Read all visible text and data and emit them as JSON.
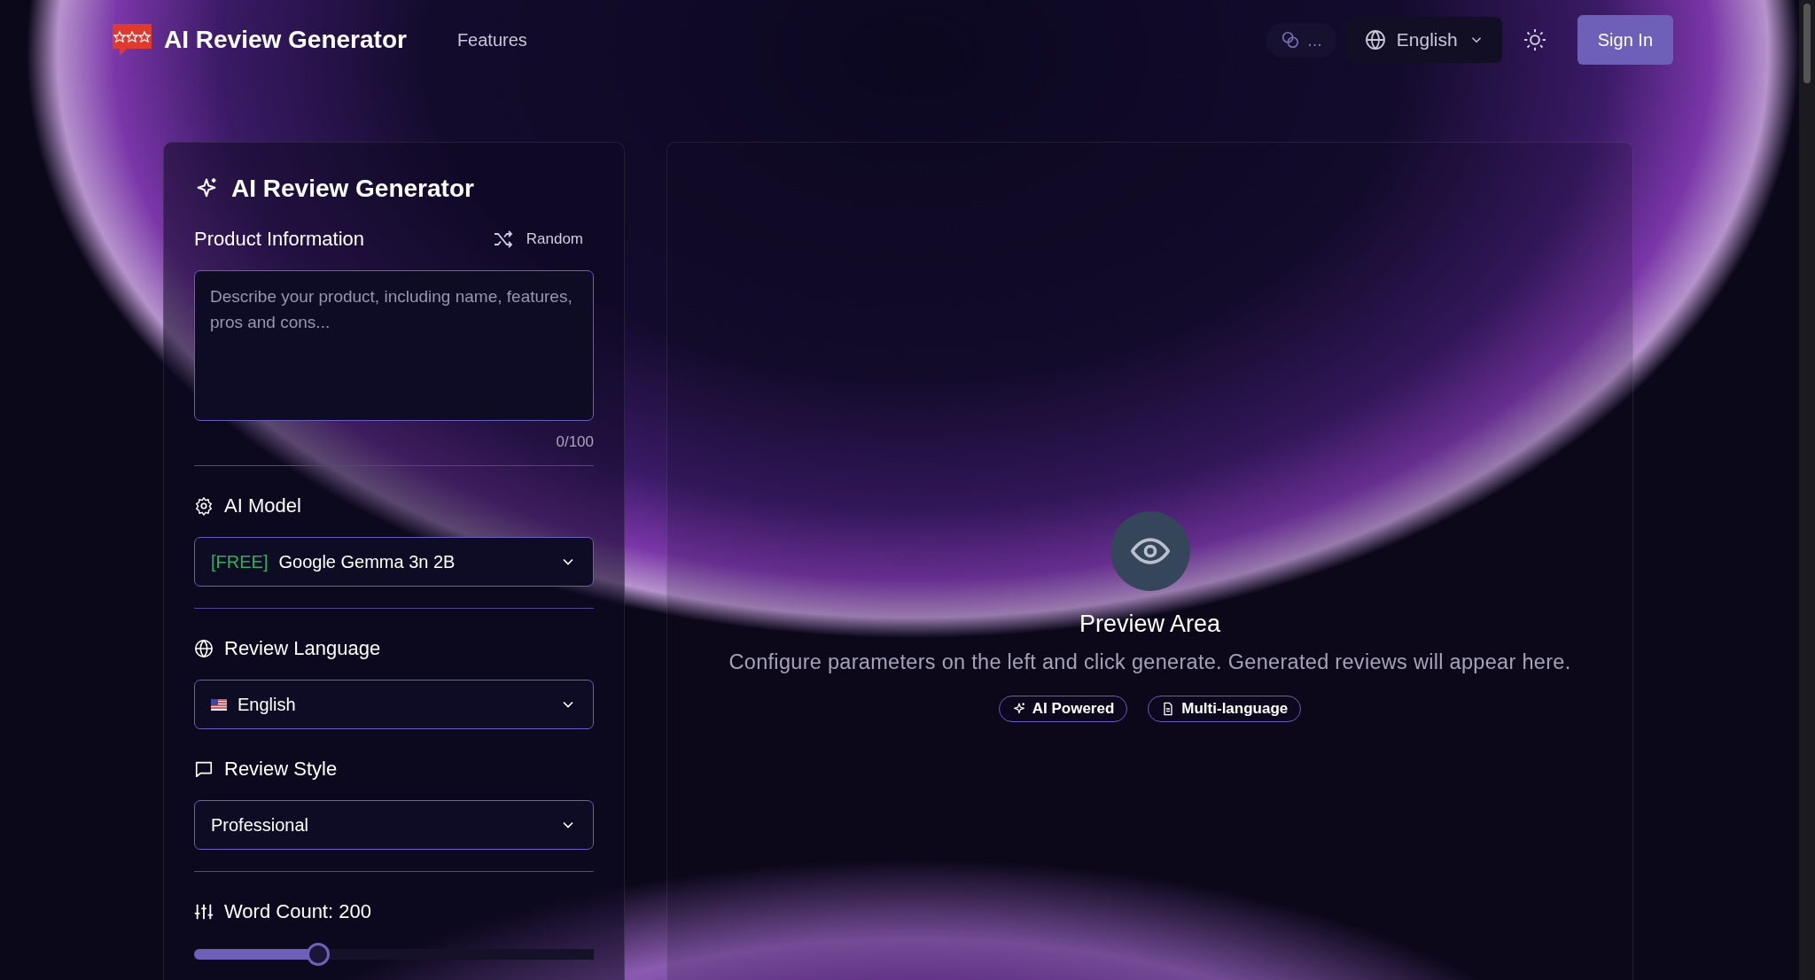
{
  "header": {
    "brand": "AI Review Generator",
    "nav": [
      {
        "label": "Features"
      }
    ],
    "credits": "...",
    "language": "English",
    "sign_in": "Sign In"
  },
  "form": {
    "title": "AI Review Generator",
    "product": {
      "label": "Product Information",
      "random": "Random",
      "placeholder": "Describe your product, including name, features, pros and cons...",
      "counter": "0/100"
    },
    "model": {
      "label": "AI Model",
      "tag": "[FREE]",
      "value": "Google Gemma 3n 2B"
    },
    "language": {
      "label": "Review Language",
      "value": "English"
    },
    "style": {
      "label": "Review Style",
      "value": "Professional"
    },
    "word_count": {
      "label": "Word Count: 200",
      "level": 0.31
    }
  },
  "preview": {
    "title": "Preview Area",
    "message": "Configure parameters on the left and click generate. Generated reviews will appear here.",
    "badges": [
      {
        "label": "AI Powered",
        "kind": "sparkle"
      },
      {
        "label": "Multi-language",
        "kind": "document"
      }
    ]
  }
}
